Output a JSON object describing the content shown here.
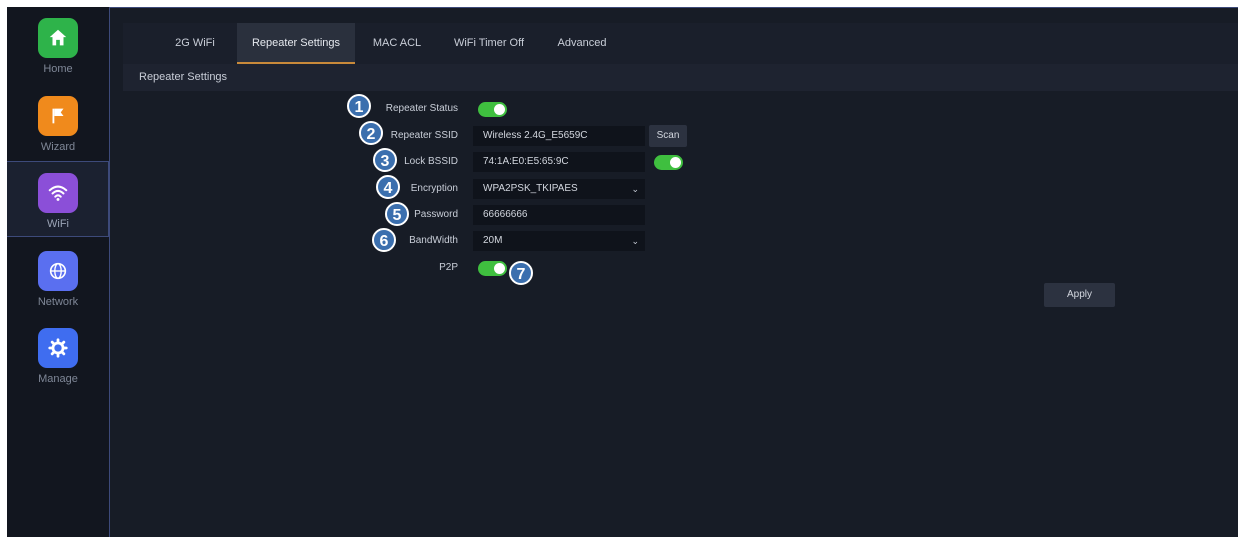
{
  "sidebar": {
    "items": [
      {
        "label": "Home",
        "icon": "home-icon",
        "color": "#2eb34a"
      },
      {
        "label": "Wizard",
        "icon": "flag-icon",
        "color": "#f08a1c"
      },
      {
        "label": "WiFi",
        "icon": "wifi-icon",
        "color": "#8b4fd8"
      },
      {
        "label": "Network",
        "icon": "globe-icon",
        "color": "#5a6ff0"
      },
      {
        "label": "Manage",
        "icon": "gear-icon",
        "color": "#3f6df0"
      }
    ]
  },
  "tabs": [
    {
      "label": "2G WiFi"
    },
    {
      "label": "Repeater Settings"
    },
    {
      "label": "MAC ACL"
    },
    {
      "label": "WiFi Timer Off"
    },
    {
      "label": "Advanced"
    }
  ],
  "section_title": "Repeater Settings",
  "form": {
    "repeater_status_label": "Repeater Status",
    "repeater_status_on": true,
    "repeater_ssid_label": "Repeater SSID",
    "repeater_ssid_value": "Wireless 2.4G_E5659C",
    "scan_label": "Scan",
    "lock_bssid_label": "Lock BSSID",
    "lock_bssid_value": "74:1A:E0:E5:65:9C",
    "lock_bssid_on": true,
    "encryption_label": "Encryption",
    "encryption_value": "WPA2PSK_TKIPAES",
    "password_label": "Password",
    "password_value": "66666666",
    "bandwidth_label": "BandWidth",
    "bandwidth_value": "20M",
    "p2p_label": "P2P",
    "p2p_on": true,
    "apply_label": "Apply"
  },
  "callouts": [
    "1",
    "2",
    "3",
    "4",
    "5",
    "6",
    "7"
  ],
  "colors": {
    "accent_tab": "#c98a3a",
    "toggle_on": "#3fbf3f",
    "callout": "#3b6fae"
  }
}
